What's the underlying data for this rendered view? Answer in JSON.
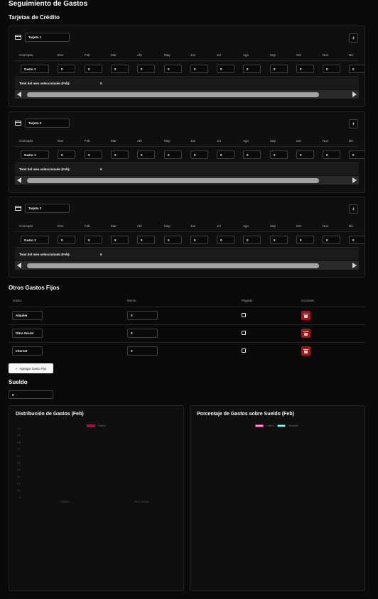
{
  "page": {
    "title": "Seguimiento de Gastos"
  },
  "cards_section": {
    "title": "Tarjetas de Crédito"
  },
  "months": [
    "Ene",
    "Feb",
    "Mar",
    "Abr",
    "May",
    "Jun",
    "Jul",
    "Ago",
    "Sep",
    "Oct",
    "Nov",
    "Dic"
  ],
  "concept_header": "Concepto",
  "total_label": "Total del mes seleccionado (Feb):",
  "add_symbol": "+",
  "cards": [
    {
      "name": "Tarjeta 1",
      "rows": [
        {
          "concept": "Gasto 1",
          "values": [
            "0",
            "0",
            "0",
            "0",
            "0",
            "0",
            "0",
            "0",
            "0",
            "0",
            "0",
            "0"
          ]
        }
      ],
      "total": "0"
    },
    {
      "name": "Tarjeta 2",
      "rows": [
        {
          "concept": "Gasto 1",
          "values": [
            "0",
            "0",
            "0",
            "0",
            "0",
            "0",
            "0",
            "0",
            "0",
            "0",
            "0",
            "0"
          ]
        }
      ],
      "total": "0"
    },
    {
      "name": "Tarjeta 3",
      "rows": [
        {
          "concept": "Gasto 1",
          "values": [
            "0",
            "0",
            "0",
            "0",
            "0",
            "0",
            "0",
            "0",
            "0",
            "0",
            "0",
            "0"
          ]
        }
      ],
      "total": "0"
    }
  ],
  "fixed": {
    "title": "Otros Gastos Fijos",
    "headers": {
      "name": "Gasto",
      "amount": "Monto",
      "paid": "Pagado",
      "actions": "Acciones"
    },
    "items": [
      {
        "name": "Alquiler",
        "amount": "0",
        "paid": false
      },
      {
        "name": "Obra Social",
        "amount": "0",
        "paid": false
      },
      {
        "name": "Internet",
        "amount": "0",
        "paid": false
      }
    ],
    "add_label": "Agregar Gasto Fijo"
  },
  "salary": {
    "title": "Sueldo",
    "value": "0"
  },
  "colors": {
    "bar_series": "#9f1239",
    "pie_gastos": "#f9a8d4",
    "pie_restante": "#99f6e4"
  },
  "chart_data": [
    {
      "type": "bar",
      "title": "Distribución de Gastos (Feb)",
      "categories": [
        "Tarjetas",
        "Otros Gastos"
      ],
      "series": [
        {
          "name": "Gastos",
          "values": [
            0,
            0
          ]
        }
      ],
      "ylim": [
        0,
        1
      ],
      "yticks": [
        "1.0",
        "0.9",
        "0.8",
        "0.7",
        "0.6",
        "0.5",
        "0.4",
        "0.3",
        "0.2",
        "0.1",
        "0"
      ],
      "legend": "top-center",
      "grid": false
    },
    {
      "type": "pie",
      "title": "Porcentaje de Gastos sobre Sueldo (Feb)",
      "labels": [
        "Gastos",
        "Restante"
      ],
      "values": [
        0,
        0
      ],
      "legend": "top-center"
    }
  ]
}
